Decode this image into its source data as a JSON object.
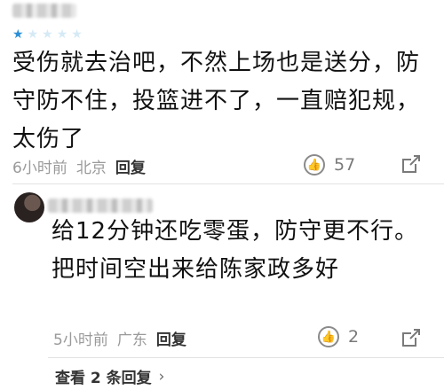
{
  "comments": [
    {
      "rating": {
        "filled": 1,
        "total": 5
      },
      "text": "受伤就去治吧，不然上场也是送分，防守防不住，投篮进不了，一直赔犯规，太伤了",
      "time": "6小时前",
      "location": "北京",
      "reply_label": "回复",
      "likes": "57"
    },
    {
      "text": "给12分钟还吃零蛋，防守更不行。把时间空出来给陈家政多好",
      "time": "5小时前",
      "location": "广东",
      "reply_label": "回复",
      "likes": "2",
      "view_replies": "查看 2 条回复",
      "view_replies_chevron": "›"
    }
  ],
  "colors": {
    "star_filled": "#2b8fd6",
    "star_empty": "#d6eaf6",
    "meta": "#9a9a9a"
  },
  "icons": {
    "like": "thumbs-up-circle-icon",
    "share": "share-arrow-icon"
  }
}
